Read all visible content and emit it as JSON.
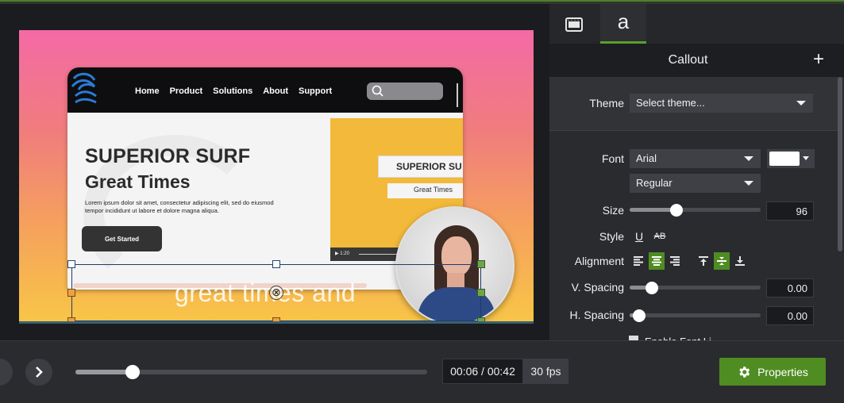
{
  "website": {
    "nav_links": [
      "Home",
      "Product",
      "Solutions",
      "About",
      "Support"
    ],
    "headline": "SUPERIOR SURF",
    "subheadline": "Great Times",
    "body": "Lorem ipsum dolor sit amet, consectetur adipiscing elit, sed do eiusmod tempor incididunt ut labore et dolore magna aliqua.",
    "cta": "Get Started",
    "panel_title": "SUPERIOR SU",
    "panel_subtitle": "Great Times",
    "video_time": "1:20"
  },
  "callout": {
    "text": "great times and"
  },
  "panel": {
    "tab_text": "a",
    "title": "Callout",
    "add_symbol": "+",
    "theme_label": "Theme",
    "theme_value": "Select theme...",
    "font_label": "Font",
    "font_value": "Arial",
    "font_color": "#ffffff",
    "weight_value": "Regular",
    "size_label": "Size",
    "size_value": "96",
    "style_label": "Style",
    "underline_glyph": "U",
    "strike_glyph": "AB",
    "alignment_label": "Alignment",
    "vspacing_label": "V. Spacing",
    "vspacing_value": "0.00",
    "hspacing_label": "H. Spacing",
    "hspacing_value": "0.00",
    "cutoff_text": "Enable Font Li..."
  },
  "bottom": {
    "time": "00:06 / 00:42",
    "fps": "30 fps",
    "properties_label": "Properties",
    "progress": 0.14
  },
  "colors": {
    "accent_green": "#4f8d22",
    "panel_bg": "#2a2b2f"
  }
}
